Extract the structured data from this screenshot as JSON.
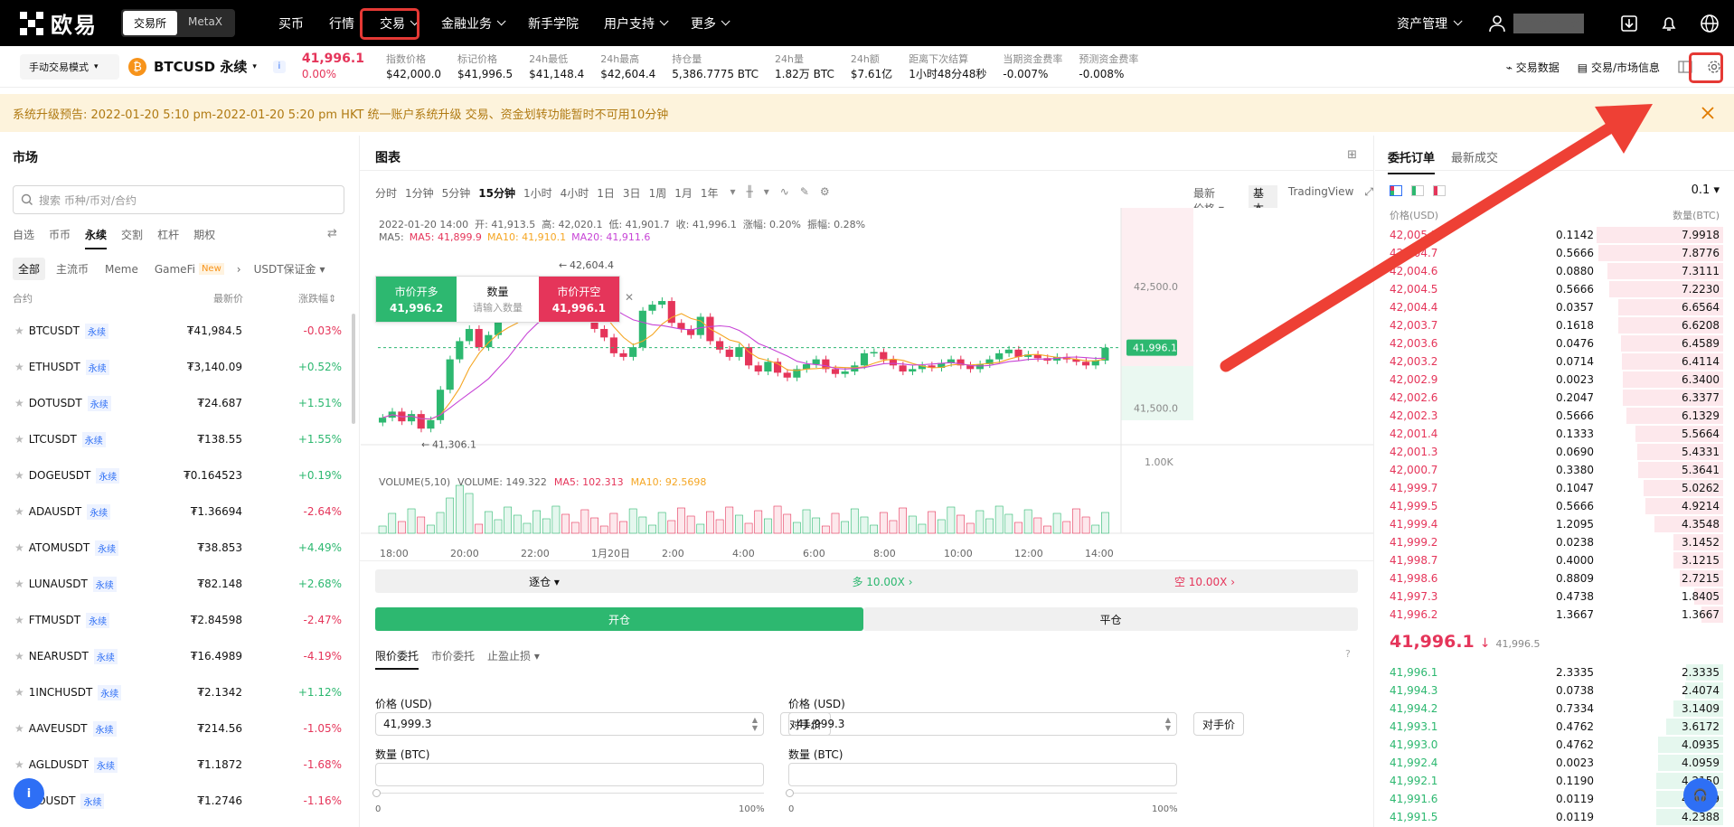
{
  "nav": {
    "brand": "欧易",
    "switch": [
      "交易所",
      "MetaX"
    ],
    "items": [
      "买币",
      "行情",
      "交易",
      "金融业务",
      "新手学院",
      "用户支持",
      "更多"
    ],
    "assets": "资产管理",
    "user": "▓▓▓▓▓▓▓▓"
  },
  "ticker": {
    "mode": "手动交易模式",
    "symbol": "BTCUSD 永续",
    "price": "41,996.1",
    "change": "0.00%",
    "stats": [
      [
        "指数价格",
        "$42,000.0"
      ],
      [
        "标记价格",
        "$41,996.5"
      ],
      [
        "24h最低",
        "$41,148.4"
      ],
      [
        "24h最高",
        "$42,604.4"
      ],
      [
        "持仓量",
        "5,386.7775 BTC"
      ],
      [
        "24h量",
        "1.82万 BTC"
      ],
      [
        "24h额",
        "$7.61亿"
      ],
      [
        "距离下次结算",
        "1小时48分48秒"
      ],
      [
        "当期资金费率",
        "-0.007%"
      ],
      [
        "预测资金费率",
        "-0.008%"
      ]
    ],
    "tools": [
      "交易数据",
      "交易/市场信息"
    ]
  },
  "banner": "系统升级预告: 2022-01-20 5:10 pm-2022-01-20 5:20 pm HKT 统一账户系统升级 交易、资金划转功能暂时不可用10分钟",
  "market": {
    "title": "市场",
    "search": "搜索 币种/币对/合约",
    "tabs": [
      "自选",
      "币币",
      "永续",
      "交割",
      "杠杆",
      "期权"
    ],
    "filters": [
      "全部",
      "主流币",
      "Meme",
      "GameFi",
      "New",
      "USDT保证金"
    ],
    "cols": [
      "合约",
      "最新价",
      "涨跌幅"
    ],
    "perp": "永续",
    "rows": [
      [
        "BTCUSDT",
        "₮41,984.5",
        "-0.03%"
      ],
      [
        "ETHUSDT",
        "₮3,140.09",
        "+0.52%"
      ],
      [
        "DOTUSDT",
        "₮24.687",
        "+1.51%"
      ],
      [
        "LTCUSDT",
        "₮138.55",
        "+1.55%"
      ],
      [
        "DOGEUSDT",
        "₮0.164523",
        "+0.19%"
      ],
      [
        "ADAUSDT",
        "₮1.36694",
        "-2.64%"
      ],
      [
        "ATOMUSDT",
        "₮38.853",
        "+4.49%"
      ],
      [
        "LUNAUSDT",
        "₮82.148",
        "+2.68%"
      ],
      [
        "FTMUSDT",
        "₮2.84598",
        "-2.47%"
      ],
      [
        "NEARUSDT",
        "₮16.4989",
        "-4.19%"
      ],
      [
        "1INCHUSDT",
        "₮2.1342",
        "+1.12%"
      ],
      [
        "AAVEUSDT",
        "₮214.56",
        "-1.05%"
      ],
      [
        "AGLDUSDT",
        "₮1.1872",
        "-1.68%"
      ],
      [
        "GOUSDT",
        "₮1.2746",
        "-1.16%"
      ]
    ]
  },
  "chart": {
    "title": "图表",
    "intervals": [
      "分时",
      "1分钟",
      "5分钟",
      "15分钟",
      "1小时",
      "4小时",
      "1日",
      "3日",
      "1周",
      "1月",
      "1年"
    ],
    "active": "15分钟",
    "pricetype": "最新价格",
    "views": [
      "基本版",
      "TradingView"
    ],
    "ohlc": "2022-01-20 14:00  开: 41,913.5  高: 42,020.1  低: 41,901.7  收: 41,996.1  涨幅: 0.20%  振幅: 0.28%",
    "ma": [
      "MA5: 41,899.9",
      "MA10: 41,910.1",
      "MA20: 41,911.6"
    ],
    "vol": [
      "VOLUME(5,10)",
      "VOLUME: 149.322",
      "MA5: 102.313",
      "MA10: 92.5698"
    ],
    "high": "42,604.4",
    "low": "41,306.1",
    "last": "41,996.1",
    "yticks": [
      "42,500.0",
      "41,500.0"
    ],
    "voltick": "1.00K",
    "xticks": [
      "18:00",
      "20:00",
      "22:00",
      "1月20日",
      "2:00",
      "4:00",
      "6:00",
      "8:00",
      "10:00",
      "12:00",
      "14:00"
    ],
    "quick": {
      "long": "市价开多",
      "longp": "41,996.2",
      "qty": "数量",
      "qtyph": "请输入数量",
      "short": "市价开空",
      "shortp": "41,996.1"
    }
  },
  "order": {
    "margin": "逐仓",
    "lev_long": "多 10.00X",
    "lev_short": "空 10.00X",
    "open": "开仓",
    "close": "平仓",
    "types": [
      "限价委托",
      "市价委托",
      "止盈止损"
    ],
    "price_label": "价格 (USD)",
    "price": "41,999.3",
    "bbo": "对手价",
    "qty_label": "数量 (BTC)",
    "min": "0",
    "max": "100%"
  },
  "book": {
    "tabs": [
      "委托订单",
      "最新成交"
    ],
    "step": "0.1",
    "cols": [
      "价格(USD)",
      "数量(BTC)"
    ],
    "asks": [
      [
        "42,005.3",
        "0.1142",
        "7.9918"
      ],
      [
        "42,004.7",
        "0.5666",
        "7.8776"
      ],
      [
        "42,004.6",
        "0.0880",
        "7.3111"
      ],
      [
        "42,004.5",
        "0.5666",
        "7.2230"
      ],
      [
        "42,004.4",
        "0.0357",
        "6.6564"
      ],
      [
        "42,003.7",
        "0.1618",
        "6.6208"
      ],
      [
        "42,003.6",
        "0.0476",
        "6.4589"
      ],
      [
        "42,003.2",
        "0.0714",
        "6.4114"
      ],
      [
        "42,002.9",
        "0.0023",
        "6.3400"
      ],
      [
        "42,002.6",
        "0.2047",
        "6.3377"
      ],
      [
        "42,002.3",
        "0.5666",
        "6.1329"
      ],
      [
        "42,001.4",
        "0.1333",
        "5.5664"
      ],
      [
        "42,001.3",
        "0.0690",
        "5.4331"
      ],
      [
        "42,000.7",
        "0.3380",
        "5.3641"
      ],
      [
        "41,999.7",
        "0.1047",
        "5.0262"
      ],
      [
        "41,999.5",
        "0.5666",
        "4.9214"
      ],
      [
        "41,999.4",
        "1.2095",
        "4.3548"
      ],
      [
        "41,999.2",
        "0.0238",
        "3.1452"
      ],
      [
        "41,998.7",
        "0.4000",
        "3.1215"
      ],
      [
        "41,998.6",
        "0.8809",
        "2.7215"
      ],
      [
        "41,997.3",
        "0.4738",
        "1.8405"
      ],
      [
        "41,996.2",
        "1.3667",
        "1.3667"
      ]
    ],
    "last": "41,996.1",
    "mark": "41,996.5",
    "bids": [
      [
        "41,996.1",
        "2.3335",
        "2.3335"
      ],
      [
        "41,994.3",
        "0.0738",
        "2.4074"
      ],
      [
        "41,994.2",
        "0.7334",
        "3.1409"
      ],
      [
        "41,993.1",
        "0.4762",
        "3.6172"
      ],
      [
        "41,993.0",
        "0.4762",
        "4.0935"
      ],
      [
        "41,992.4",
        "0.0023",
        "4.0959"
      ],
      [
        "41,992.1",
        "0.1190",
        "4.2150"
      ],
      [
        "41,991.6",
        "0.0119",
        "4.2269"
      ],
      [
        "41,991.5",
        "0.0119",
        "4.2388"
      ]
    ]
  },
  "colors": {
    "up": "#2db870",
    "down": "#e5355a",
    "annot": "#e53935"
  }
}
